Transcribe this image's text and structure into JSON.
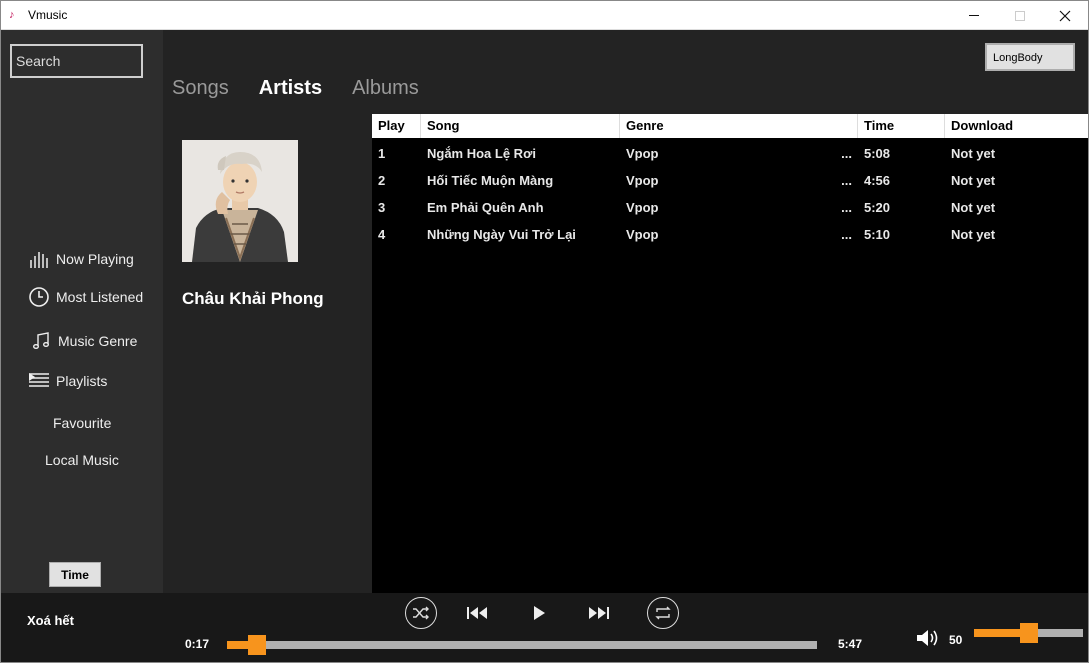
{
  "window": {
    "title": "Vmusic"
  },
  "sidebar": {
    "search_placeholder": "Search",
    "items": [
      {
        "label": "Now Playing",
        "icon": "bars-icon"
      },
      {
        "label": "Most Listened",
        "icon": "clock-icon"
      },
      {
        "label": "Music Genre",
        "icon": "music-note-icon"
      },
      {
        "label": "Playlists",
        "icon": "playlist-icon"
      },
      {
        "label": "Favourite"
      },
      {
        "label": "Local Music"
      }
    ],
    "time_button": "Time"
  },
  "header": {
    "tabs": [
      "Songs",
      "Artists",
      "Albums"
    ],
    "active_tab": "Artists",
    "account_button": "LongBody"
  },
  "artist": {
    "name": "Châu Khải Phong"
  },
  "table": {
    "columns": [
      "Play",
      "Song",
      "Genre",
      "Time",
      "Download"
    ],
    "rows": [
      {
        "play": "1",
        "song": "Ngắm Hoa Lệ Rơi",
        "genre": "Vpop",
        "genre_more": "...",
        "time": "5:08",
        "download": "Not yet"
      },
      {
        "play": "2",
        "song": "Hối Tiếc Muộn Màng",
        "genre": "Vpop",
        "genre_more": "...",
        "time": "4:56",
        "download": "Not yet"
      },
      {
        "play": "3",
        "song": "Em Phải Quên Anh",
        "genre": "Vpop",
        "genre_more": "...",
        "time": "5:20",
        "download": "Not yet"
      },
      {
        "play": "4",
        "song": "Những Ngày Vui Trở Lại",
        "genre": "Vpop",
        "genre_more": "...",
        "time": "5:10",
        "download": "Not yet"
      }
    ]
  },
  "player": {
    "clear_label": "Xoá hết",
    "current_time": "0:17",
    "total_time": "5:47",
    "progress_fraction": 0.05,
    "volume": "50",
    "volume_fraction": 0.5,
    "accent_color": "#f7941d"
  }
}
